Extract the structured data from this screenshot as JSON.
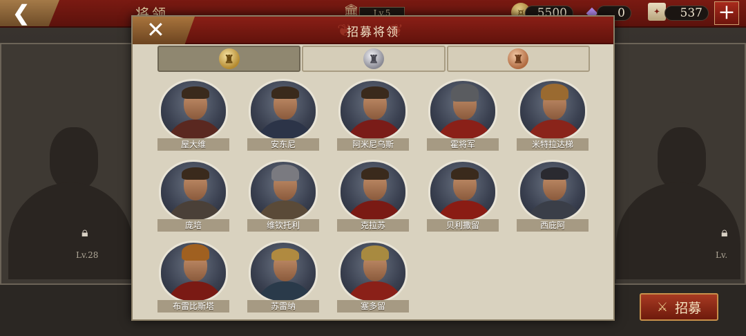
{
  "topbar": {
    "page_title": "将领",
    "level_label": "Lv.5",
    "coins": "5500",
    "gems": "0",
    "scrolls": "537"
  },
  "side_panels": {
    "left_level": "Lv.28",
    "right_level": "Lv."
  },
  "dialog": {
    "title": "招募将领",
    "tabs": [
      {
        "emblem": "gold-helmet-icon",
        "active": true
      },
      {
        "emblem": "silver-helmet-icon",
        "active": false
      },
      {
        "emblem": "bronze-helmet-icon",
        "active": false
      }
    ],
    "heroes": [
      {
        "name": "屋大维"
      },
      {
        "name": "安东尼"
      },
      {
        "name": "阿米尼乌斯"
      },
      {
        "name": "霍将军"
      },
      {
        "name": "米特拉达梯"
      },
      {
        "name": "庞培"
      },
      {
        "name": "维钦托利"
      },
      {
        "name": "克拉苏"
      },
      {
        "name": "贝利撒留"
      },
      {
        "name": "西庇阿"
      },
      {
        "name": "布雷比斯塔"
      },
      {
        "name": "苏雷纳"
      },
      {
        "name": "塞多留"
      }
    ]
  },
  "recruit_button": {
    "label": "招募"
  },
  "colors": {
    "accent_red": "#8a1f16",
    "gold": "#c8904a",
    "dialog_bg": "#d9d2bf"
  }
}
